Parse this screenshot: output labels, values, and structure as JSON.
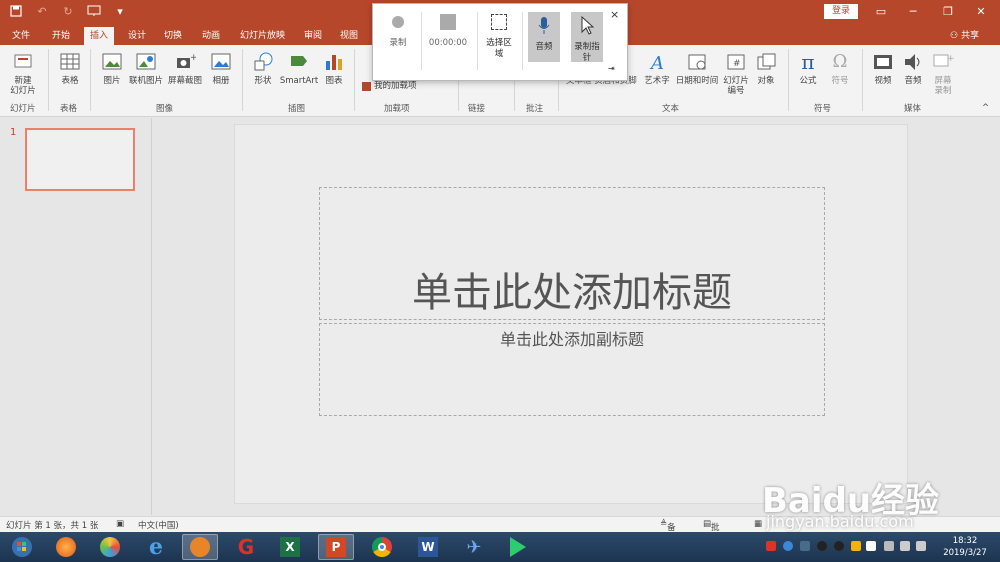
{
  "titlebar": {
    "login": "登录",
    "icons": [
      "save-icon",
      "undo-icon",
      "redo-icon",
      "start-from-beginning-icon",
      "customize-qat-icon"
    ]
  },
  "tabs": [
    "文件",
    "开始",
    "插入",
    "设计",
    "切换",
    "动画",
    "幻灯片放映",
    "审阅",
    "视图"
  ],
  "active_tab": "插入",
  "share": "共享",
  "ribbon": {
    "buttons": {
      "new_slide": "新建\n幻灯片",
      "table": "表格",
      "picture": "图片",
      "online_picture": "联机图片",
      "screenshot": "屏幕截图",
      "album": "相册",
      "shapes": "形状",
      "smartart": "SmartArt",
      "chart": "图表",
      "my_addins": "我的加载项",
      "link": "链接",
      "comment": "批注",
      "textbox_header": "文本框 页眉和页脚",
      "wordart": "艺术字",
      "datetime": "日期和时间",
      "slide_number": "幻灯片\n编号",
      "object": "对象",
      "equation": "公式",
      "symbol": "符号",
      "video": "视频",
      "audio": "音频",
      "screen_recording": "屏幕\n录制"
    },
    "groups": {
      "slides": "幻灯片",
      "tables": "表格",
      "images": "图像",
      "illustrations": "插图",
      "addins": "加载项",
      "links": "链接",
      "comments": "批注",
      "text": "文本",
      "symbols": "符号",
      "media": "媒体"
    }
  },
  "recorder": {
    "record": "录制",
    "time": "00:00:00",
    "select_area": "选择区\n域",
    "audio": "音频",
    "record_pointer": "录制指\n针",
    "close": "×"
  },
  "thumbs": {
    "number": "1"
  },
  "slide": {
    "title_placeholder": "单击此处添加标题",
    "subtitle_placeholder": "单击此处添加副标题"
  },
  "status": {
    "slide_info": "幻灯片 第 1 张，共 1 张",
    "language": "中文(中国)",
    "notes": "备注",
    "comments": "批注"
  },
  "clock": {
    "time": "18:32",
    "date": "2019/3/27"
  },
  "watermark": {
    "brand": "Baidu经验",
    "site": "jingyan.baidu.com"
  },
  "colors": {
    "accent": "#b7472a",
    "ribbon_bg": "#f3f3f3",
    "thumb_border": "#e8826a"
  }
}
